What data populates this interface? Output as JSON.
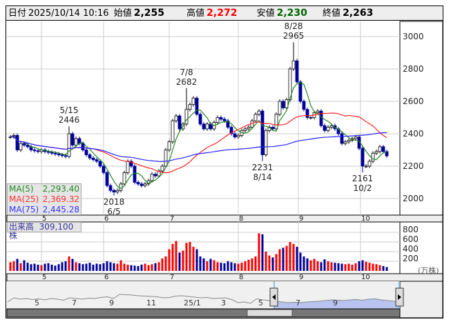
{
  "header": {
    "date_label": "日付",
    "datetime": "2025/10/14 10:16",
    "open_label": "始値",
    "open": "2,255",
    "high_label": "高値",
    "high": "2,272",
    "low_label": "安値",
    "low": "2,230",
    "close_label": "終値",
    "close": "2,263"
  },
  "colors": {
    "up": "#ff0000",
    "down": "#000099",
    "ma5": "#228822",
    "ma25": "#ff2222",
    "ma75": "#2222ff",
    "low_val": "#006600"
  },
  "legend": {
    "ma5_label": "MA(5)",
    "ma5": "2,293.40",
    "ma25_label": "MA(25)",
    "ma25": "2,369.32",
    "ma75_label": "MA(75)",
    "ma75": "2,445.28"
  },
  "volume": {
    "label": "出来高",
    "value": "309,100株",
    "unit": "(万株)",
    "ticks": [
      "800",
      "600",
      "400",
      "200"
    ]
  },
  "chart_data": {
    "type": "candlestick",
    "yticks": [
      3000,
      2800,
      2600,
      2400,
      2200,
      2000
    ],
    "ylim": [
      1900,
      3110
    ],
    "months": [
      "5",
      "6",
      "7",
      "8",
      "9",
      "10"
    ],
    "closes": [
      2380,
      2390,
      2300,
      2340,
      2330,
      2320,
      2300,
      2295,
      2290,
      2300,
      2290,
      2285,
      2280,
      2275,
      2270,
      2265,
      2260,
      2400,
      2330,
      2370,
      2340,
      2300,
      2270,
      2250,
      2240,
      2230,
      2200,
      2160,
      2080,
      2050,
      2040,
      2050,
      2090,
      2160,
      2230,
      2200,
      2100,
      2090,
      2080,
      2090,
      2110,
      2150,
      2140,
      2170,
      2200,
      2300,
      2350,
      2480,
      2510,
      2430,
      2460,
      2550,
      2580,
      2620,
      2520,
      2460,
      2430,
      2460,
      2430,
      2470,
      2500,
      2490,
      2480,
      2440,
      2400,
      2380,
      2390,
      2420,
      2430,
      2440,
      2480,
      2520,
      2540,
      2270,
      2420,
      2440,
      2430,
      2520,
      2600,
      2560,
      2610,
      2800,
      2850,
      2720,
      2600,
      2550,
      2500,
      2500,
      2530,
      2540,
      2450,
      2420,
      2440,
      2450,
      2430,
      2400,
      2340,
      2350,
      2360,
      2370,
      2380,
      2310,
      2200,
      2200,
      2230,
      2280,
      2290,
      2320,
      2290,
      2263
    ],
    "volumes": [
      180,
      200,
      250,
      160,
      220,
      170,
      140,
      150,
      130,
      120,
      150,
      160,
      130,
      110,
      140,
      180,
      200,
      300,
      250,
      180,
      160,
      140,
      150,
      170,
      130,
      150,
      140,
      160,
      200,
      180,
      160,
      150,
      220,
      150,
      130,
      120,
      110,
      100,
      130,
      150,
      120,
      140,
      160,
      180,
      260,
      300,
      450,
      560,
      620,
      380,
      420,
      580,
      600,
      500,
      450,
      300,
      260,
      200,
      250,
      220,
      180,
      170,
      160,
      200,
      180,
      160,
      150,
      170,
      200,
      230,
      260,
      300,
      780,
      760,
      400,
      320,
      280,
      350,
      450,
      480,
      520,
      600,
      560,
      500,
      380,
      300,
      260,
      220,
      250,
      200,
      180,
      240,
      200,
      180,
      170,
      160,
      150,
      140,
      150,
      130,
      160,
      200,
      220,
      190,
      170,
      150,
      140,
      120,
      100,
      80
    ],
    "annotations": [
      {
        "index": 17,
        "date": "5/15",
        "price": "2446",
        "value": 2446,
        "type": "high"
      },
      {
        "index": 30,
        "date": "6/5",
        "price": "2018",
        "value": 2018,
        "type": "low"
      },
      {
        "index": 51,
        "date": "7/8",
        "price": "2682",
        "value": 2682,
        "type": "high"
      },
      {
        "index": 73,
        "date": "8/14",
        "price": "2231",
        "value": 2231,
        "type": "low"
      },
      {
        "index": 82,
        "date": "8/28",
        "price": "2965",
        "value": 2965,
        "type": "high"
      },
      {
        "index": 102,
        "date": "10/2",
        "price": "2161",
        "value": 2161,
        "type": "low"
      }
    ],
    "navigator": {
      "labels": [
        "5",
        "7",
        "9",
        "11",
        "25/1",
        "3",
        "5",
        "7",
        "9"
      ],
      "series": [
        40,
        52,
        48,
        50,
        47,
        49,
        46,
        50,
        48,
        45,
        52,
        50,
        48,
        51,
        50,
        53,
        55,
        50,
        62,
        61,
        60,
        58,
        57,
        56,
        55,
        52,
        53,
        57,
        58,
        56,
        54,
        52,
        53,
        50,
        51,
        52,
        47,
        38,
        40,
        36,
        49,
        46,
        44,
        42,
        40,
        38,
        39,
        38,
        40,
        41,
        42,
        44,
        46,
        45,
        44,
        46,
        47,
        45,
        48,
        49,
        46,
        44,
        42,
        41
      ]
    }
  }
}
